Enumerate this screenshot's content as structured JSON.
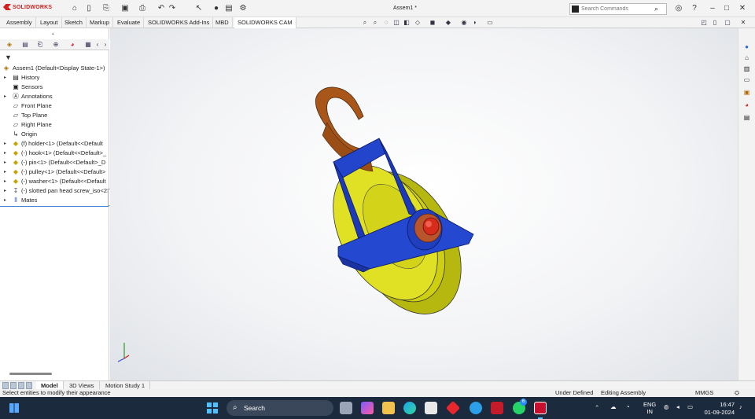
{
  "app": {
    "logo": "SOLIDWORKS",
    "doc_title": "Assem1 *"
  },
  "search": {
    "placeholder": "Search Commands"
  },
  "tabs": [
    {
      "label": "Assembly"
    },
    {
      "label": "Layout"
    },
    {
      "label": "Sketch"
    },
    {
      "label": "Markup"
    },
    {
      "label": "Evaluate"
    },
    {
      "label": "SOLIDWORKS Add-Ins"
    },
    {
      "label": "MBD"
    },
    {
      "label": "SOLIDWORKS CAM"
    }
  ],
  "tree": {
    "root": "Assem1  (Default<Display State-1>)",
    "items": [
      {
        "label": "History",
        "icon": "history-icon"
      },
      {
        "label": "Sensors",
        "icon": "sensor-icon"
      },
      {
        "label": "Annotations",
        "icon": "annotation-icon"
      },
      {
        "label": "Front Plane",
        "icon": "plane-icon"
      },
      {
        "label": "Top Plane",
        "icon": "plane-icon"
      },
      {
        "label": "Right Plane",
        "icon": "plane-icon"
      },
      {
        "label": "Origin",
        "icon": "origin-icon"
      },
      {
        "label": "(f) holder<1> (Default<<Default",
        "icon": "part-icon"
      },
      {
        "label": "(-) hook<1> (Default<<Default>_",
        "icon": "part-icon"
      },
      {
        "label": "(-) pin<1> (Default<<Default>_D",
        "icon": "part-icon"
      },
      {
        "label": "(-) pulley<1> (Default<<Default>",
        "icon": "part-icon"
      },
      {
        "label": "(-) washer<1> (Default<<Default",
        "icon": "part-icon"
      },
      {
        "label": "(-) slotted pan head screw_iso<2>",
        "icon": "screw-icon"
      },
      {
        "label": "Mates",
        "icon": "mates-icon"
      }
    ]
  },
  "bottom_tabs": [
    {
      "label": "Model"
    },
    {
      "label": "3D Views"
    },
    {
      "label": "Motion Study 1"
    }
  ],
  "status": {
    "message": "Select entities to modify their appearance",
    "definition": "Under Defined",
    "mode": "Editing Assembly",
    "units": "MMGS"
  },
  "taskbar": {
    "search_label": "Search",
    "lang_top": "ENG",
    "lang_bottom": "IN",
    "time": "16:47",
    "date": "01-09-2024",
    "badge": "6"
  },
  "colors": {
    "accent": "#d4201f",
    "holder": "#1f3fbf",
    "hook": "#a8561a",
    "pulley": "#d9d91a",
    "pin": "#d72b1b"
  }
}
